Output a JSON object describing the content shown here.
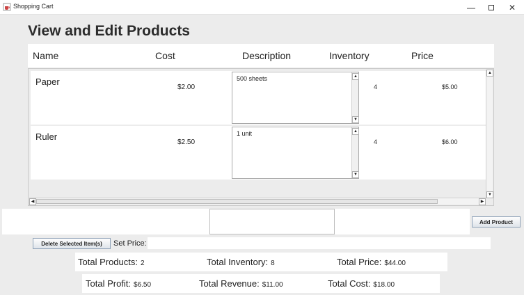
{
  "window": {
    "title": "Shopping Cart",
    "icon": "java-cup-icon"
  },
  "heading": "View and Edit Products",
  "columns": [
    "Name",
    "Cost",
    "Description",
    "Inventory",
    "Price"
  ],
  "products": [
    {
      "name": "Paper",
      "cost": "$2.00",
      "description": "500 sheets",
      "inventory": "4",
      "price": "$5.00"
    },
    {
      "name": "Ruler",
      "cost": "$2.50",
      "description": "1 unit",
      "inventory": "4",
      "price": "$6.00"
    }
  ],
  "buttons": {
    "add_product": "Add Product",
    "delete_selected": "Delete Selected Item(s)"
  },
  "set_price_label": "Set Price:",
  "totals": {
    "products_label": "Total Products:",
    "products_value": "2",
    "inventory_label": "Total Inventory:",
    "inventory_value": "8",
    "price_label": "Total Price:",
    "price_value": "$44.00",
    "profit_label": "Total Profit:",
    "profit_value": "$6.50",
    "revenue_label": "Total Revenue:",
    "revenue_value": "$11.00",
    "cost_label": "Total Cost:",
    "cost_value": "$18.00"
  }
}
